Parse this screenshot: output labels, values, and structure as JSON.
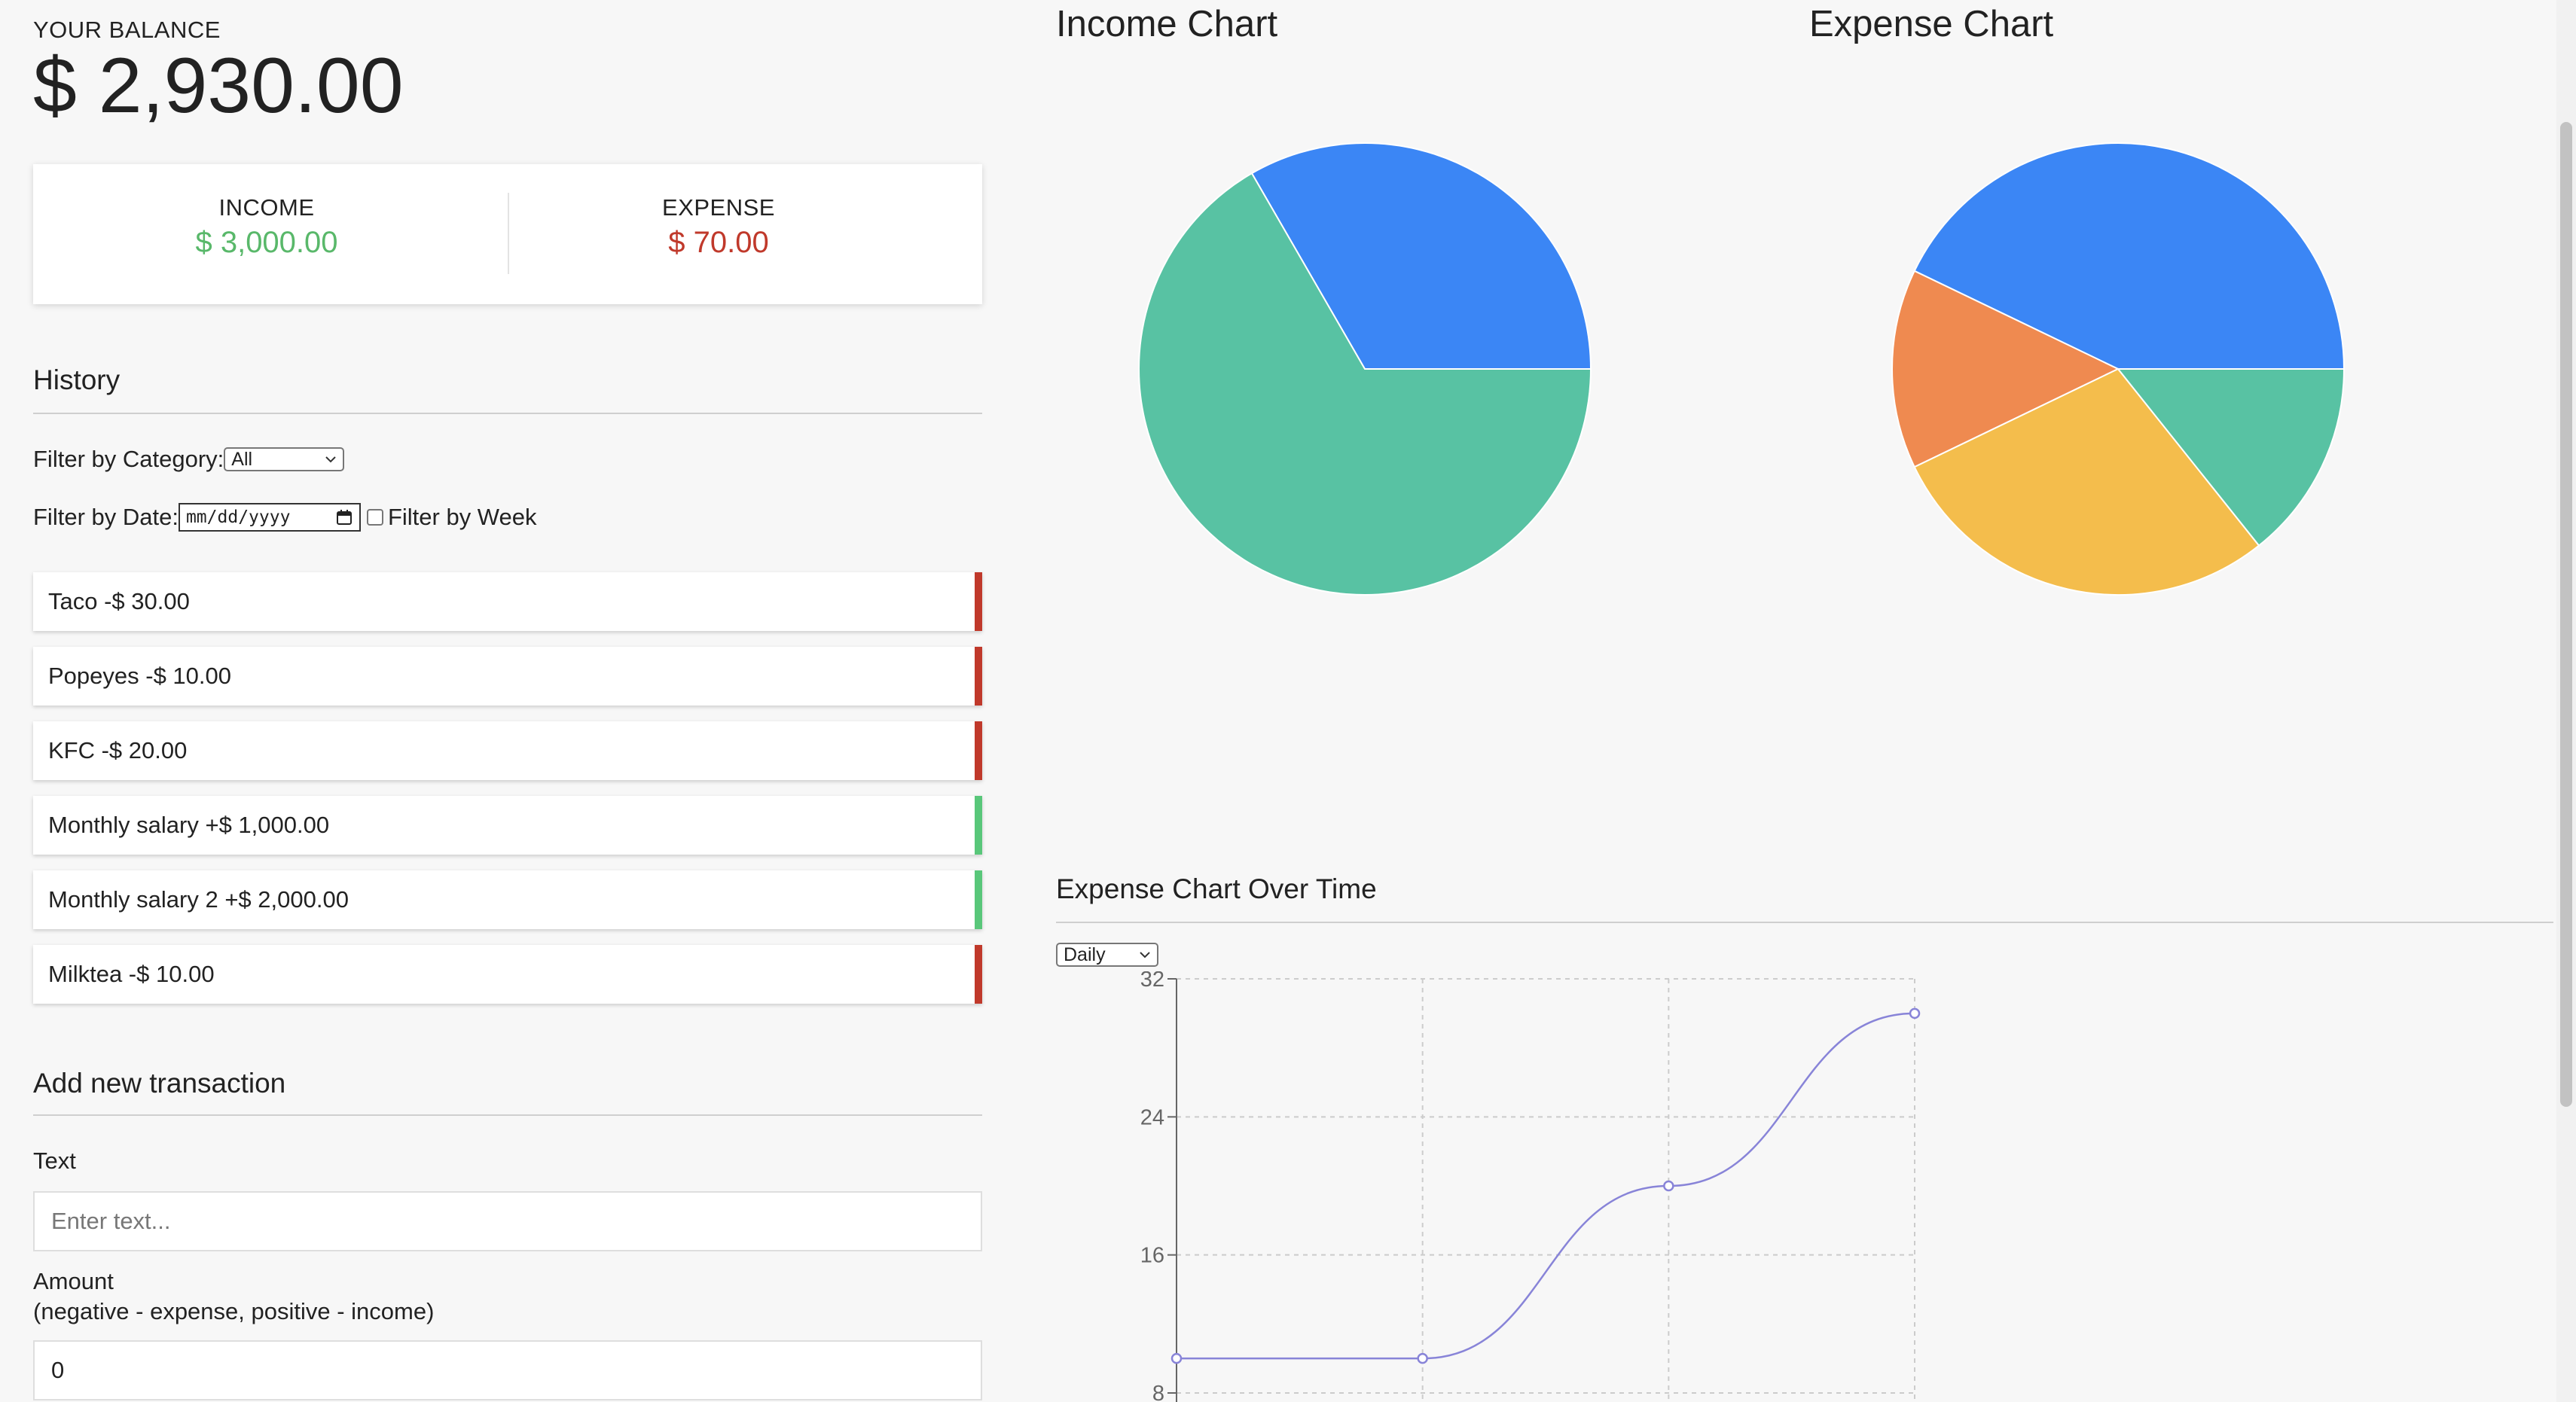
{
  "balance": {
    "label": "YOUR BALANCE",
    "value": "$ 2,930.00"
  },
  "summary": {
    "income_label": "INCOME",
    "income_value": "$ 3,000.00",
    "expense_label": "EXPENSE",
    "expense_value": "$ 70.00",
    "colors": {
      "income": "#59b86a",
      "expense": "#c0392b"
    }
  },
  "history": {
    "title": "History",
    "filter_category_label": "Filter by Category:",
    "filter_category_value": "All",
    "filter_date_label": "Filter by Date:",
    "filter_date_placeholder": "mm/dd/yyyy",
    "filter_week_label": "Filter by Week",
    "filter_week_checked": false,
    "items": [
      {
        "text": "Taco -$ 30.00",
        "type": "expense"
      },
      {
        "text": "Popeyes -$ 10.00",
        "type": "expense"
      },
      {
        "text": "KFC -$ 20.00",
        "type": "expense"
      },
      {
        "text": "Monthly salary +$ 1,000.00",
        "type": "income"
      },
      {
        "text": "Monthly salary 2 +$ 2,000.00",
        "type": "income"
      },
      {
        "text": "Milktea -$ 10.00",
        "type": "expense"
      }
    ]
  },
  "form": {
    "title": "Add new transaction",
    "text_label": "Text",
    "text_placeholder": "Enter text...",
    "amount_label": "Amount",
    "amount_hint": "(negative - expense, positive - income)",
    "amount_value": "0"
  },
  "charts": {
    "income_title": "Income Chart",
    "expense_title": "Expense Chart",
    "over_time_title": "Expense Chart Over Time",
    "period_value": "Daily"
  },
  "chart_data": [
    {
      "type": "pie",
      "title": "Income Chart",
      "slices": [
        {
          "value": 1000,
          "color": "#3b86f5"
        },
        {
          "value": 2000,
          "color": "#58c2a3"
        }
      ]
    },
    {
      "type": "pie",
      "title": "Expense Chart",
      "slices": [
        {
          "value": 30,
          "color": "#3b86f5"
        },
        {
          "value": 10,
          "color": "#ef8a50"
        },
        {
          "value": 20,
          "color": "#f4bd4c"
        },
        {
          "value": 10,
          "color": "#58c2a3"
        }
      ]
    },
    {
      "type": "line",
      "title": "Expense Chart Over Time",
      "x": [
        1,
        2,
        3,
        4
      ],
      "y": [
        10,
        10,
        20,
        30
      ],
      "ylim": [
        8,
        32
      ],
      "yticks": [
        8,
        16,
        24,
        32
      ],
      "grid": true,
      "color": "#8884d8"
    }
  ]
}
